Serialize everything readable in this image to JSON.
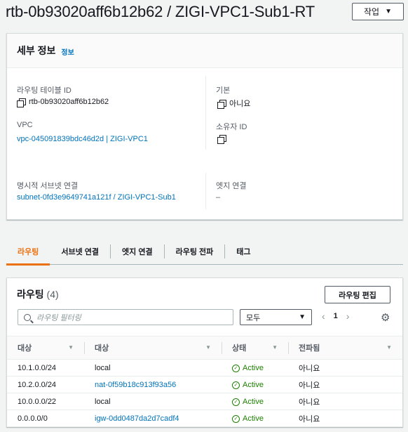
{
  "header": {
    "title": "rtb-0b93020aff6b12b62 / ZIGI-VPC1-Sub1-RT",
    "action_label": "작업"
  },
  "details": {
    "heading": "세부 정보",
    "info_link": "정보",
    "route_table_id_label": "라우팅 테이블 ID",
    "route_table_id_value": "rtb-0b93020aff6b12b62",
    "main_label": "기본",
    "main_value": "아니요",
    "vpc_label": "VPC",
    "vpc_value": "vpc-045091839bdc46d2d | ZIGI-VPC1",
    "owner_label": "소유자 ID",
    "explicit_subnet_label": "명시적 서브넷 연결",
    "explicit_subnet_value": "subnet-0fd3e9649741a121f / ZIGI-VPC1-Sub1",
    "edge_label": "엣지 연결",
    "edge_value": "–"
  },
  "tabs": [
    "라우팅",
    "서브넷 연결",
    "엣지 연결",
    "라우팅 전파",
    "태그"
  ],
  "routes": {
    "heading": "라우팅",
    "count": "(4)",
    "edit_label": "라우팅 편집",
    "search_placeholder": "라우팅 필터링",
    "filter_value": "모두",
    "page": "1",
    "columns": [
      "대상",
      "대상",
      "상태",
      "전파됨"
    ],
    "rows": [
      {
        "destination": "10.1.0.0/24",
        "target": "local",
        "status": "Active",
        "propagated": "아니요"
      },
      {
        "destination": "10.2.0.0/24",
        "target": "nat-0f59b18c913f93a56",
        "status": "Active",
        "propagated": "아니요"
      },
      {
        "destination": "10.0.0.0/22",
        "target": "local",
        "status": "Active",
        "propagated": "아니요"
      },
      {
        "destination": "0.0.0.0/0",
        "target": "igw-0dd0487da2d7cadf4",
        "status": "Active",
        "propagated": "아니요"
      }
    ]
  },
  "colors": {
    "accent": "#ec7211",
    "link": "#0073bb",
    "success": "#1d8102"
  }
}
